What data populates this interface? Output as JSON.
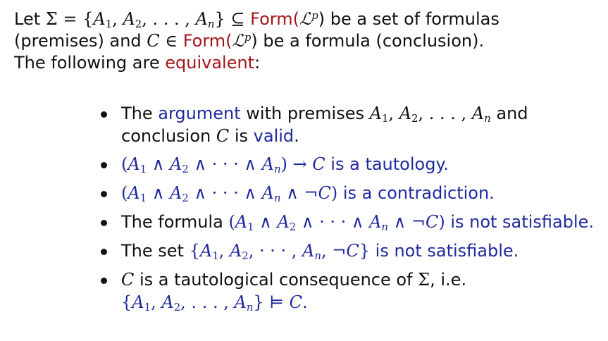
{
  "intro": {
    "line1": {
      "t1": "Let ",
      "sigma": "Σ",
      "eq": " = {",
      "a": "A",
      "s1": "1",
      "c1": ", ",
      "s2": "2",
      "c2": ", . . . , ",
      "sn": "n",
      "close": "} ⊆ ",
      "form": "Form(",
      "lp": "ℒ",
      "p": "p",
      "paren": ")",
      "t2": " be a set of formulas"
    },
    "line2": {
      "t1": "(premises) and ",
      "c": "C",
      "in": " ∈ ",
      "form": "Form(",
      "lp": "ℒ",
      "p": "p",
      "paren": ")",
      "t2": " be a formula (conclusion)."
    },
    "line3": {
      "t1": "The following are ",
      "eqv": "equivalent",
      "colon": ":"
    }
  },
  "bullets": {
    "b1": {
      "t1": "The ",
      "argument": "argument",
      "t2": " with premises ",
      "a": "A",
      "s1": "1",
      "c1": ", ",
      "s2": "2",
      "c2": ", . . . , ",
      "sn": "n",
      "t3": " and",
      "t4": "conclusion ",
      "c": "C",
      "t5": " is ",
      "valid": "valid",
      "t6": "."
    },
    "b2": {
      "open": "(",
      "a": "A",
      "s1": "1",
      "and1": " ∧ ",
      "s2": "2",
      "and2": " ∧ · · · ∧ ",
      "sn": "n",
      "close": ") → ",
      "c": "C",
      "t": " is a tautology."
    },
    "b3": {
      "open": "(",
      "a": "A",
      "s1": "1",
      "and1": " ∧ ",
      "s2": "2",
      "and2": " ∧ · · · ∧ ",
      "sn": "n",
      "and3": " ∧ ¬",
      "c": "C",
      "close": ")",
      "t": " is a contradiction."
    },
    "b4": {
      "t1": "The formula ",
      "open": "(",
      "a": "A",
      "s1": "1",
      "and1": " ∧ ",
      "s2": "2",
      "and2": " ∧ · · · ∧ ",
      "sn": "n",
      "and3": " ∧ ¬",
      "c": "C",
      "close": ")",
      "t2": " is not satisfiable."
    },
    "b5": {
      "t1": "The set ",
      "open": "{",
      "a": "A",
      "s1": "1",
      "c1": ", ",
      "s2": "2",
      "c2": ", · · · , ",
      "sn": "n",
      "neg": ", ¬",
      "c": "C",
      "close": "}",
      "t2": " is not satisfiable."
    },
    "b6": {
      "c": "C",
      "t1": " is a tautological consequence of ",
      "sigma": "Σ",
      "t2": ", i.e.",
      "open": "{",
      "a": "A",
      "s1": "1",
      "c1": ", ",
      "s2": "2",
      "c2": ", . . . , ",
      "sn": "n",
      "close": "} ⊨ ",
      "c2b": "C",
      "dot": "."
    }
  },
  "colors": {
    "red": "#a3161a",
    "blue": "#202a9e",
    "text": "#111111"
  }
}
